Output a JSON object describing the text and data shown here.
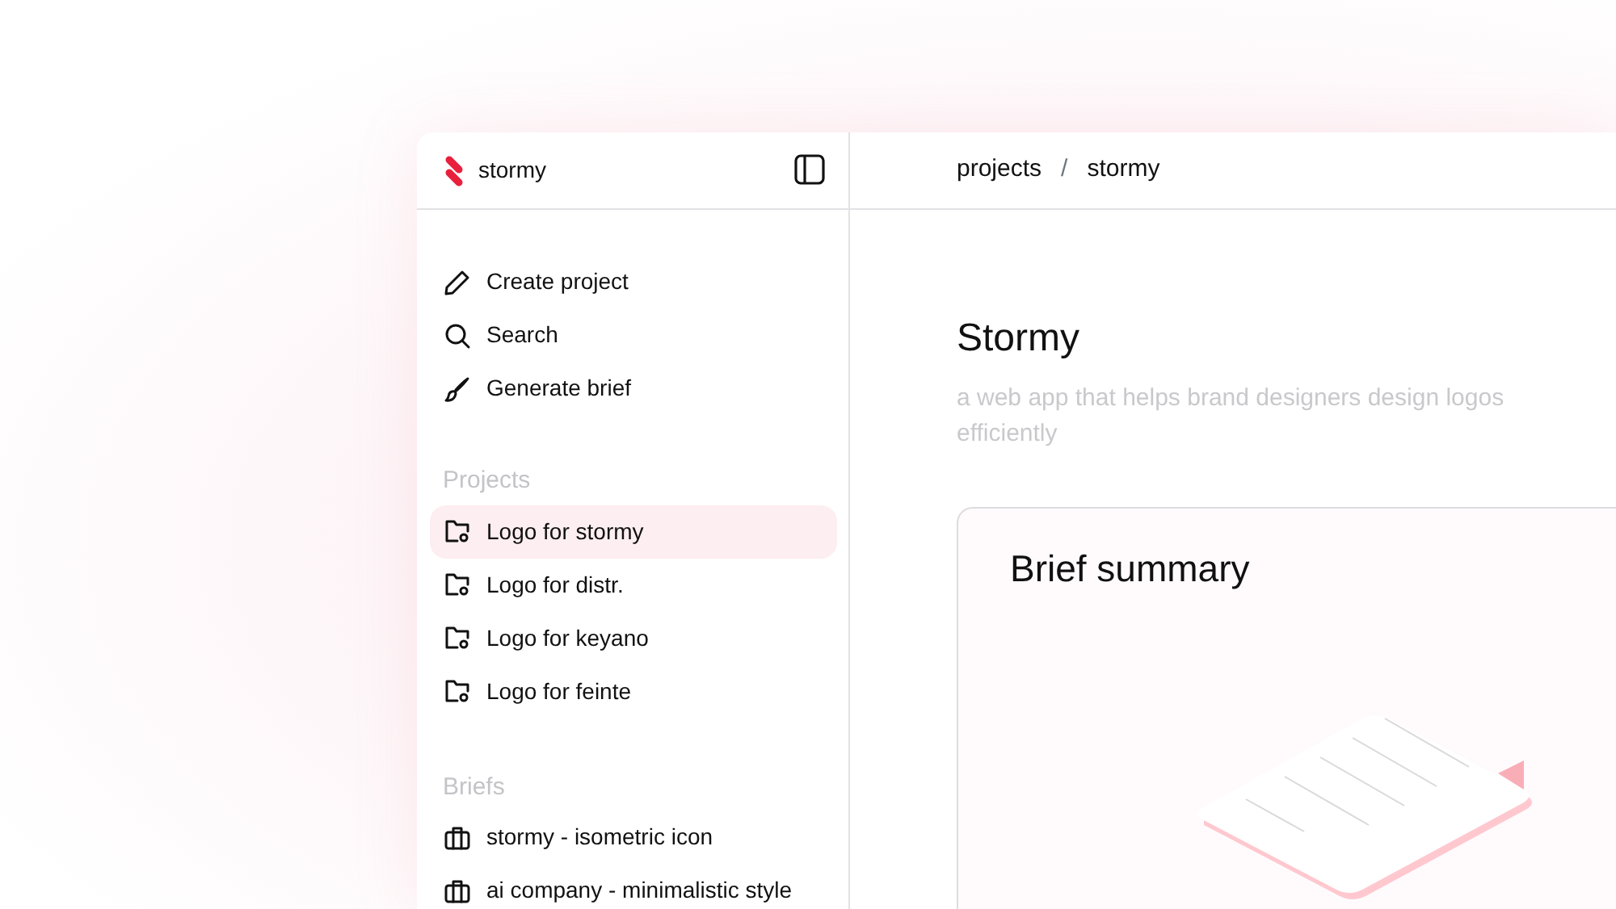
{
  "brand": {
    "name": "stormy"
  },
  "actions": [
    {
      "label": "Create project",
      "kind": "pencil"
    },
    {
      "label": "Search",
      "kind": "search"
    },
    {
      "label": "Generate brief",
      "kind": "brush"
    }
  ],
  "projects": {
    "heading": "Projects",
    "items": [
      {
        "label": "Logo for stormy",
        "selected": true
      },
      {
        "label": "Logo for distr.",
        "selected": false
      },
      {
        "label": "Logo for keyano",
        "selected": false
      },
      {
        "label": "Logo for feinte",
        "selected": false
      }
    ]
  },
  "briefs": {
    "heading": "Briefs",
    "items": [
      {
        "label": "stormy - isometric icon"
      },
      {
        "label": "ai company - minimalistic style"
      }
    ]
  },
  "breadcrumb": {
    "items": [
      "projects",
      "stormy"
    ],
    "separator": "/"
  },
  "project": {
    "title": "Stormy",
    "description": "a web app that helps brand designers design logos efficiently"
  },
  "card": {
    "title": "Brief summary"
  }
}
